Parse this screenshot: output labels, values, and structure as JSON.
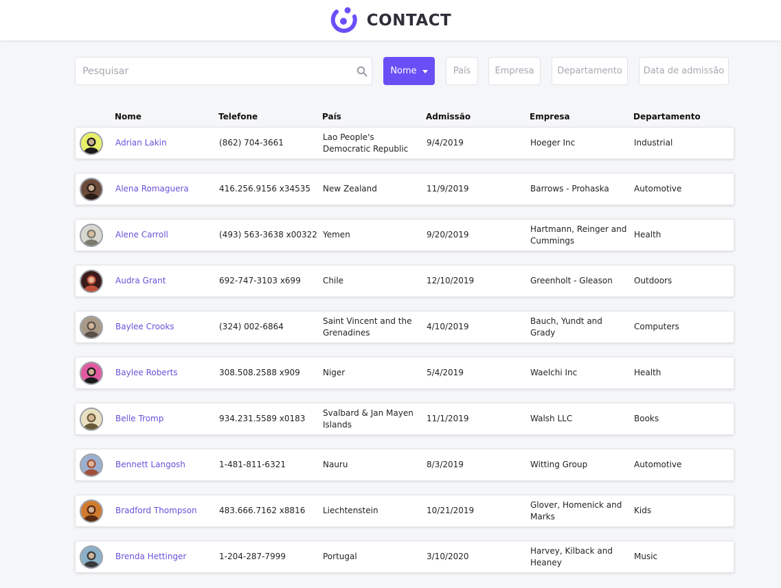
{
  "app": {
    "title": "CONTACT",
    "logo_icon": "contact-logo-icon",
    "accent_color": "#6a4ff7"
  },
  "search": {
    "placeholder": "Pesquisar",
    "value": "",
    "icon": "search-icon"
  },
  "filters": [
    {
      "label": "Nome",
      "active": true,
      "icon": "caret-down-icon"
    },
    {
      "label": "País",
      "active": false
    },
    {
      "label": "Empresa",
      "active": false
    },
    {
      "label": "Departamento",
      "active": false
    },
    {
      "label": "Data de admissão",
      "active": false
    }
  ],
  "table": {
    "columns": [
      "Nome",
      "Telefone",
      "País",
      "Admissão",
      "Empresa",
      "Departamento"
    ],
    "rows": [
      {
        "name": "Adrian Lakin",
        "phone": "(862) 704-3661",
        "country": "Lao People's Democratic Republic",
        "admission": "9/4/2019",
        "company": "Hoeger Inc",
        "department": "Industrial",
        "avatar_colors": [
          "#e8f06a",
          "#1a1a1a"
        ]
      },
      {
        "name": "Alena Romaguera",
        "phone": "416.256.9156 x34535",
        "country": "New Zealand",
        "admission": "11/9/2019",
        "company": "Barrows - Prohaska",
        "department": "Automotive",
        "avatar_colors": [
          "#6a4a3a",
          "#2b1d18"
        ]
      },
      {
        "name": "Alene Carroll",
        "phone": "(493) 563-3638 x00322",
        "country": "Yemen",
        "admission": "9/20/2019",
        "company": "Hartmann, Reinger and Cummings",
        "department": "Health",
        "avatar_colors": [
          "#d8d8d0",
          "#7a7a70"
        ]
      },
      {
        "name": "Audra Grant",
        "phone": "692-747-3103 x699",
        "country": "Chile",
        "admission": "12/10/2019",
        "company": "Greenholt - Gleason",
        "department": "Outdoors",
        "avatar_colors": [
          "#3a1a1a",
          "#c0503a"
        ]
      },
      {
        "name": "Baylee Crooks",
        "phone": "(324) 002-6864",
        "country": "Saint Vincent and the Grenadines",
        "admission": "4/10/2019",
        "company": "Bauch, Yundt and Grady",
        "department": "Computers",
        "avatar_colors": [
          "#a89a86",
          "#5a5048"
        ]
      },
      {
        "name": "Baylee Roberts",
        "phone": "308.508.2588 x909",
        "country": "Niger",
        "admission": "5/4/2019",
        "company": "Waelchi Inc",
        "department": "Health",
        "avatar_colors": [
          "#e05aa0",
          "#1a1a1a"
        ]
      },
      {
        "name": "Belle Tromp",
        "phone": "934.231.5589 x0183",
        "country": "Svalbard & Jan Mayen Islands",
        "admission": "11/1/2019",
        "company": "Walsh LLC",
        "department": "Books",
        "avatar_colors": [
          "#e8e0c0",
          "#6a5a3a"
        ]
      },
      {
        "name": "Bennett Langosh",
        "phone": "1-481-811-6321",
        "country": "Nauru",
        "admission": "8/3/2019",
        "company": "Witting Group",
        "department": "Automotive",
        "avatar_colors": [
          "#9ab0d0",
          "#a0503a"
        ]
      },
      {
        "name": "Bradford Thompson",
        "phone": "483.666.7162 x8816",
        "country": "Liechtenstein",
        "admission": "10/21/2019",
        "company": "Glover, Homenick and Marks",
        "department": "Kids",
        "avatar_colors": [
          "#d07a30",
          "#5a2a10"
        ]
      },
      {
        "name": "Brenda Hettinger",
        "phone": "1-204-287-7999",
        "country": "Portugal",
        "admission": "3/10/2020",
        "company": "Harvey, Kilback and Heaney",
        "department": "Music",
        "avatar_colors": [
          "#8ab0c8",
          "#3a3a3a"
        ]
      }
    ]
  }
}
